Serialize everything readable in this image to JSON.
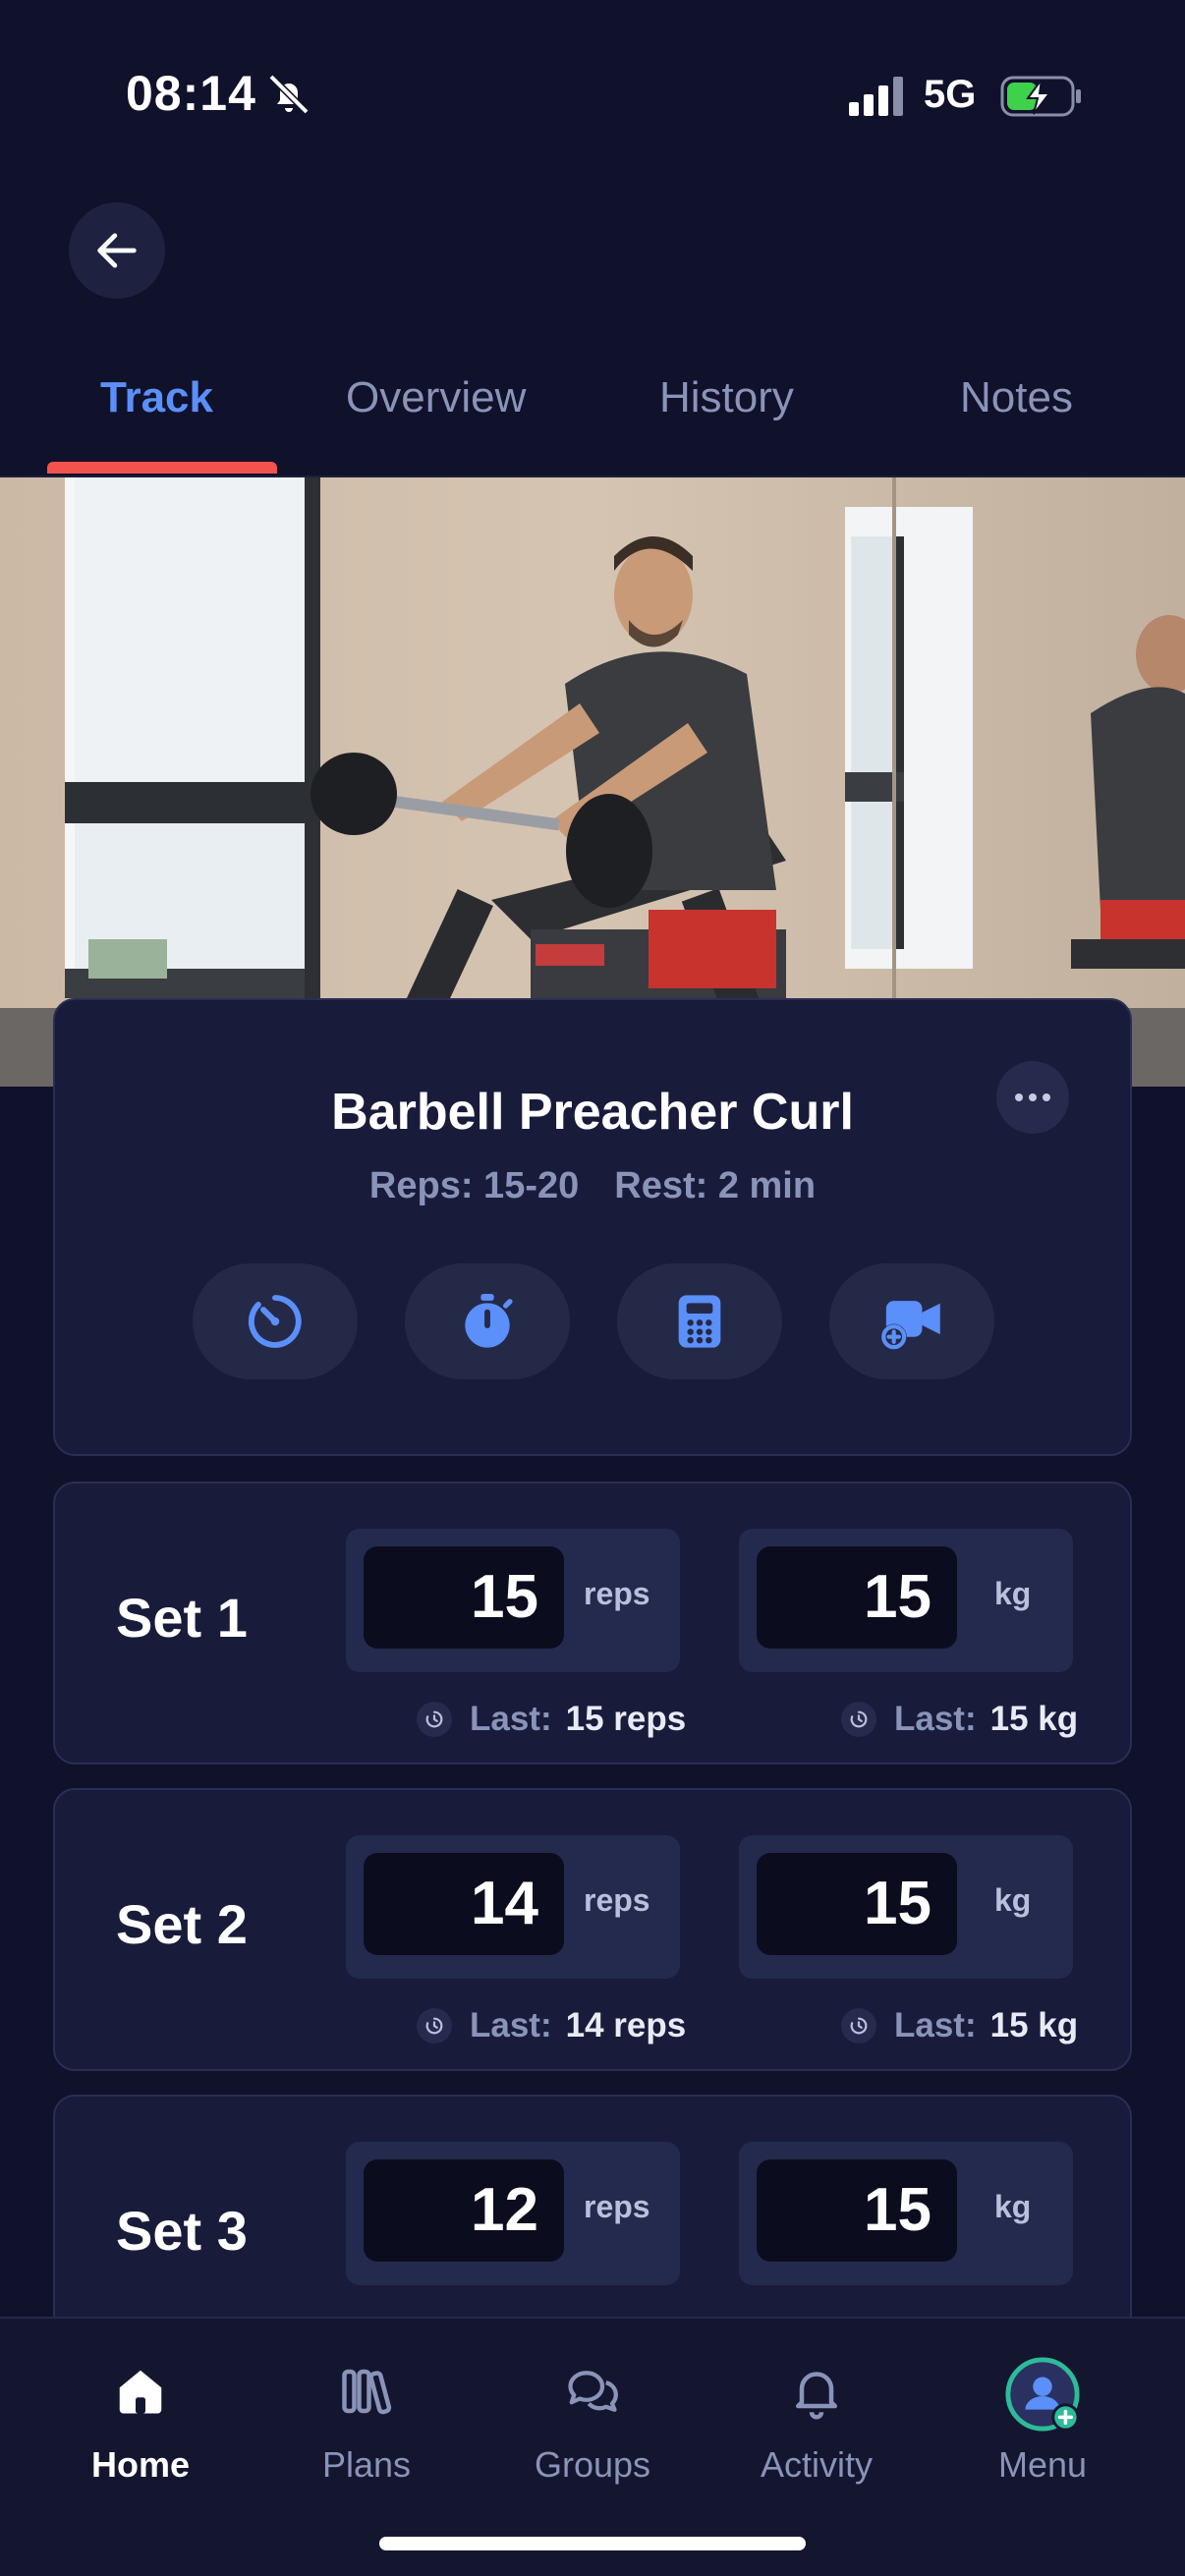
{
  "status_bar": {
    "time": "08:14",
    "network": "5G"
  },
  "tabs": [
    {
      "label": "Track",
      "active": true
    },
    {
      "label": "Overview",
      "active": false
    },
    {
      "label": "History",
      "active": false
    },
    {
      "label": "Notes",
      "active": false
    }
  ],
  "exercise": {
    "title": "Barbell Preacher Curl",
    "reps": "Reps: 15-20",
    "rest": "Rest: 2 min",
    "tools": [
      "timer-icon",
      "stopwatch-icon",
      "calculator-icon",
      "add-video-icon"
    ]
  },
  "sets": [
    {
      "label": "Set 1",
      "reps": "15",
      "reps_unit": "reps",
      "weight": "15",
      "weight_unit": "kg",
      "last_label": "Last:",
      "last_reps": "15 reps",
      "last_weight": "15 kg"
    },
    {
      "label": "Set 2",
      "reps": "14",
      "reps_unit": "reps",
      "weight": "15",
      "weight_unit": "kg",
      "last_label": "Last:",
      "last_reps": "14 reps",
      "last_weight": "15 kg"
    },
    {
      "label": "Set 3",
      "reps": "12",
      "reps_unit": "reps",
      "weight": "15",
      "weight_unit": "kg"
    }
  ],
  "bottom_nav": [
    {
      "label": "Home",
      "icon": "home-icon",
      "active": true
    },
    {
      "label": "Plans",
      "icon": "plans-icon",
      "active": false
    },
    {
      "label": "Groups",
      "icon": "groups-icon",
      "active": false
    },
    {
      "label": "Activity",
      "icon": "bell-icon",
      "active": false
    },
    {
      "label": "Menu",
      "icon": "avatar-icon",
      "active": false
    }
  ],
  "colors": {
    "background": "#10112a",
    "card": "#191b3b",
    "accent": "#5b8ff9",
    "tab_indicator": "#f4524d"
  }
}
